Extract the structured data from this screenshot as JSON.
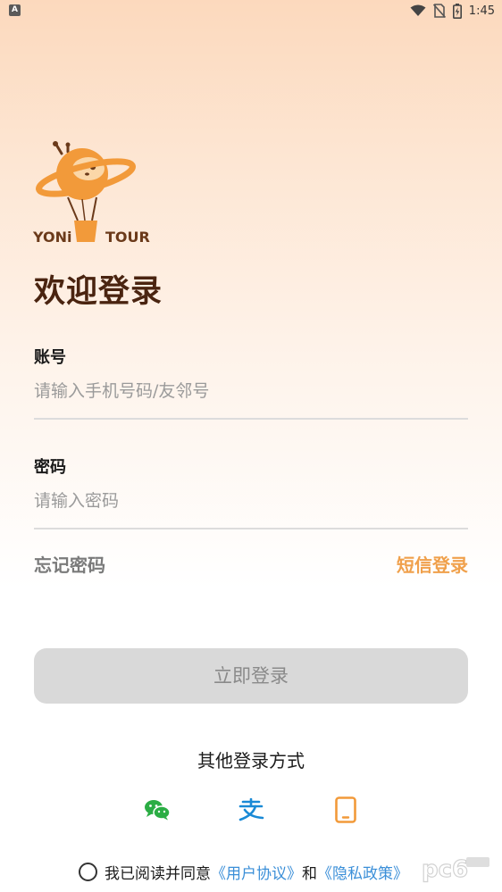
{
  "status_bar": {
    "left_badge": "A",
    "time": "1:45",
    "icons": [
      "wifi-icon",
      "no-sim-icon",
      "battery-charging-icon"
    ]
  },
  "logo": {
    "brand_left": "YONi",
    "brand_right": "TOUR",
    "colors": {
      "orange": "#f29a3a",
      "brown": "#6b3a1a"
    }
  },
  "title": "欢迎登录",
  "account": {
    "label": "账号",
    "value": "",
    "placeholder": "请输入手机号码/友邻号"
  },
  "password": {
    "label": "密码",
    "value": "",
    "placeholder": "请输入密码"
  },
  "links": {
    "forgot": "忘记密码",
    "sms_login": "短信登录"
  },
  "login_button": "立即登录",
  "other_login": {
    "title": "其他登录方式",
    "methods": [
      {
        "name": "wechat",
        "icon": "wechat-icon",
        "color": "#2bad44"
      },
      {
        "name": "alipay",
        "icon": "alipay-icon",
        "color": "#1a8ad6"
      },
      {
        "name": "phone",
        "icon": "phone-icon",
        "color": "#f29a3a"
      }
    ]
  },
  "agreement": {
    "prefix": "我已阅读并同意",
    "user_agreement": "《用户协议》",
    "conjunction": "和",
    "privacy_policy": "《隐私政策》"
  },
  "watermark": "pc6",
  "colors": {
    "accent_orange": "#f0a04b",
    "title_brown": "#4a2410",
    "link_blue": "#3b8fd8",
    "button_disabled": "#d9d9d9"
  }
}
